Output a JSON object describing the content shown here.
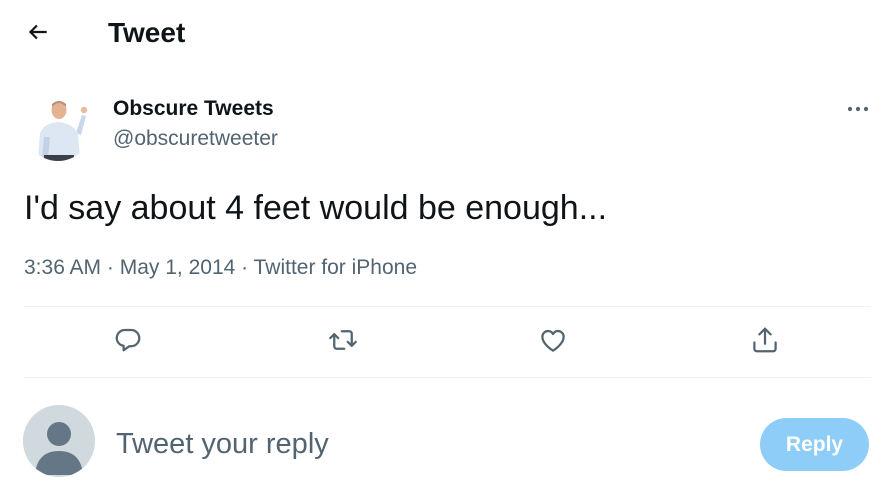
{
  "header": {
    "back_icon": "arrow-left-icon",
    "title": "Tweet"
  },
  "tweet": {
    "author": {
      "display_name": "Obscure Tweets",
      "handle": "@obscuretweeter",
      "avatar_icon": "profile-photo"
    },
    "more_icon": "more-dots-icon",
    "text": "I'd say about 4 feet would be enough...",
    "meta": {
      "time": "3:36 AM",
      "separator1": " · ",
      "date": "May 1, 2014",
      "separator2": " · ",
      "source": "Twitter for iPhone"
    },
    "actions": [
      {
        "name": "reply",
        "icon": "comment-icon"
      },
      {
        "name": "retweet",
        "icon": "retweet-icon"
      },
      {
        "name": "like",
        "icon": "heart-icon"
      },
      {
        "name": "share",
        "icon": "share-icon"
      }
    ]
  },
  "composer": {
    "avatar_icon": "default-avatar-icon",
    "placeholder": "Tweet your reply",
    "value": "",
    "reply_label": "Reply"
  },
  "colors": {
    "text_primary": "#0f1419",
    "text_secondary": "#536471",
    "divider": "#eff3f4",
    "reply_button_disabled": "#8ecdf8",
    "icon": "#536471"
  }
}
